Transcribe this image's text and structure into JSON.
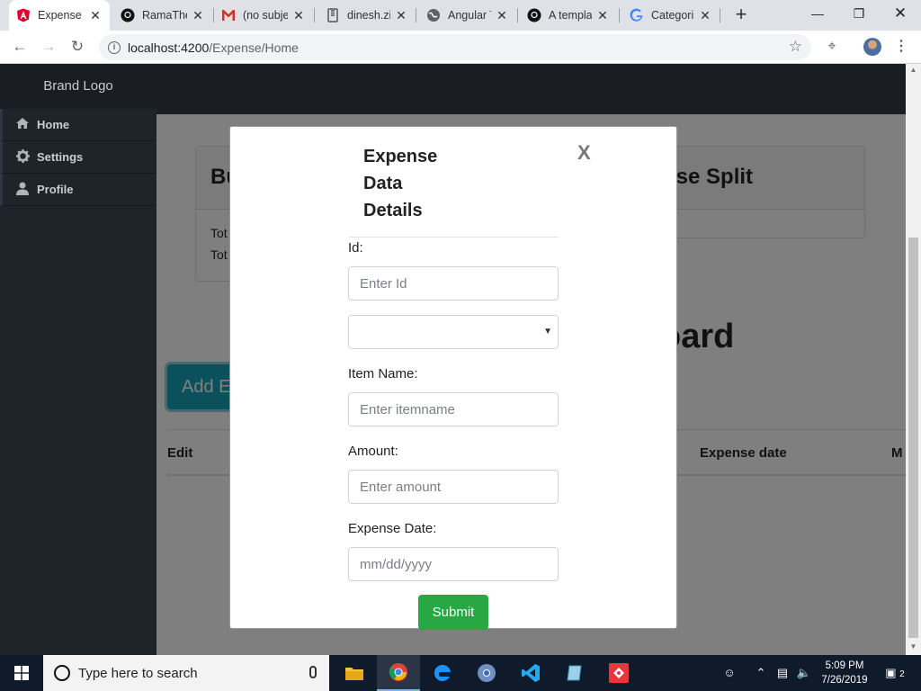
{
  "browser": {
    "tabs": [
      {
        "title": "Expense",
        "icon": "angular-icon",
        "active": true
      },
      {
        "title": "RamaThe",
        "icon": "github-icon"
      },
      {
        "title": "(no subje",
        "icon": "gmail-icon"
      },
      {
        "title": "dinesh.zi",
        "icon": "zip-icon"
      },
      {
        "title": "Angular T",
        "icon": "globe-icon"
      },
      {
        "title": "A templa",
        "icon": "github-icon"
      },
      {
        "title": "Categori",
        "icon": "google-icon"
      }
    ],
    "url_host": "localhost:4200",
    "url_path": "/Expense/Home"
  },
  "sidebar": {
    "brand": "Brand Logo",
    "items": [
      {
        "label": "Home",
        "icon": "home-icon"
      },
      {
        "label": "Settings",
        "icon": "gear-icon"
      },
      {
        "label": "Profile",
        "icon": "user-icon"
      }
    ]
  },
  "page": {
    "card_left_header": "Bu",
    "card_left_lines": [
      "Tot",
      "Tot"
    ],
    "card_right_header": "ise Split",
    "dashboard_title": "oard",
    "add_button": "Add E",
    "table_headers": {
      "edit": "Edit",
      "expense_date": "Expense date",
      "more": "M"
    }
  },
  "modal": {
    "title": "Expense Data Details",
    "close": "X",
    "id_label": "Id:",
    "id_placeholder": "Enter Id",
    "item_label": "Item Name:",
    "item_placeholder": "Enter itemname",
    "amount_label": "Amount:",
    "amount_placeholder": "Enter amount",
    "date_label": "Expense Date:",
    "date_placeholder": "mm/dd/yyyy",
    "submit": "Submit"
  },
  "taskbar": {
    "search_placeholder": "Type here to search",
    "time": "5:09 PM",
    "date": "7/26/2019",
    "notifications": "2"
  },
  "colors": {
    "sidebar_bg": "#1f242b",
    "submit_green": "#28a745",
    "add_button_teal": "#17a2b8"
  }
}
